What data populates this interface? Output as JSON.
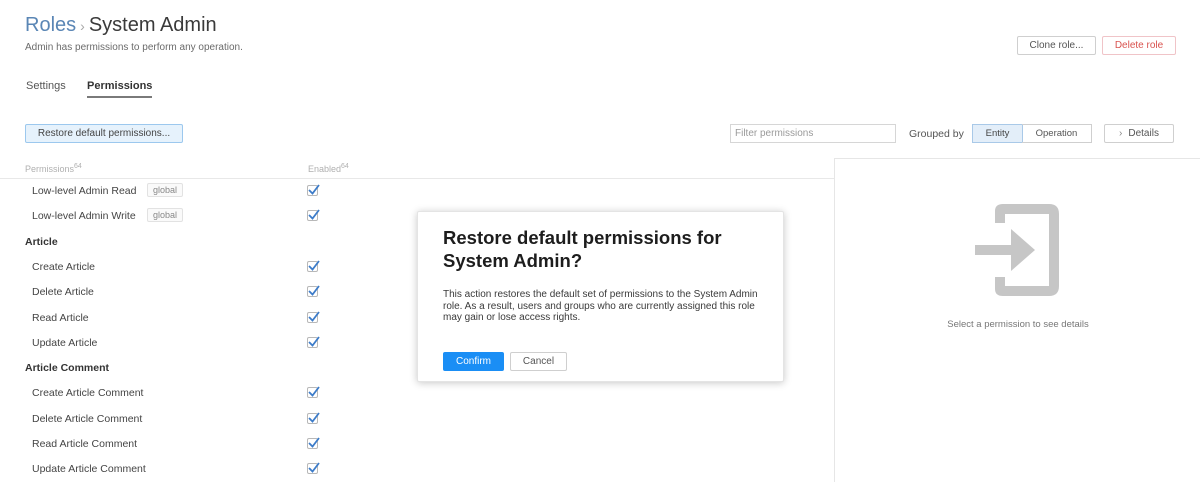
{
  "breadcrumb": {
    "root": "Roles",
    "separator": "›",
    "current": "System Admin"
  },
  "subtitle": "Admin has permissions to perform any operation.",
  "actions": {
    "clone": "Clone role...",
    "delete": "Delete role"
  },
  "tabs": [
    {
      "label": "Settings",
      "active": false
    },
    {
      "label": "Permissions",
      "active": true
    }
  ],
  "toolbar": {
    "restore": "Restore default permissions...",
    "filter_placeholder": "Filter permissions",
    "grouped_by": "Grouped by",
    "group_options": [
      {
        "label": "Entity",
        "active": true
      },
      {
        "label": "Operation",
        "active": false
      }
    ],
    "details": "Details"
  },
  "columns": {
    "permissions": "Permissions",
    "permissions_count": "64",
    "enabled": "Enabled",
    "enabled_count": "64"
  },
  "ungrouped_rows": [
    {
      "label": "Low-level Admin Read",
      "tag": "global",
      "enabled": true
    },
    {
      "label": "Low-level Admin Write",
      "tag": "global",
      "enabled": true
    }
  ],
  "groups": [
    {
      "name": "Article",
      "rows": [
        {
          "label": "Create Article",
          "enabled": true
        },
        {
          "label": "Delete Article",
          "enabled": true
        },
        {
          "label": "Read Article",
          "enabled": true
        },
        {
          "label": "Update Article",
          "enabled": true
        }
      ]
    },
    {
      "name": "Article Comment",
      "rows": [
        {
          "label": "Create Article Comment",
          "enabled": true
        },
        {
          "label": "Delete Article Comment",
          "enabled": true
        },
        {
          "label": "Read Article Comment",
          "enabled": true
        },
        {
          "label": "Update Article Comment",
          "enabled": true
        }
      ]
    }
  ],
  "details_panel": {
    "icon": "sign-in-icon",
    "text": "Select a permission to see details"
  },
  "modal": {
    "title": "Restore default permissions for System Admin?",
    "body": "This action restores the default set of permissions to the System Admin role. As a result, users and groups who are currently assigned this role may gain or lose access rights.",
    "confirm": "Confirm",
    "cancel": "Cancel"
  },
  "colors": {
    "accent": "#1a8ef5",
    "link": "#5a86b5",
    "danger": "#d9534f",
    "check": "#3d7cc9"
  }
}
